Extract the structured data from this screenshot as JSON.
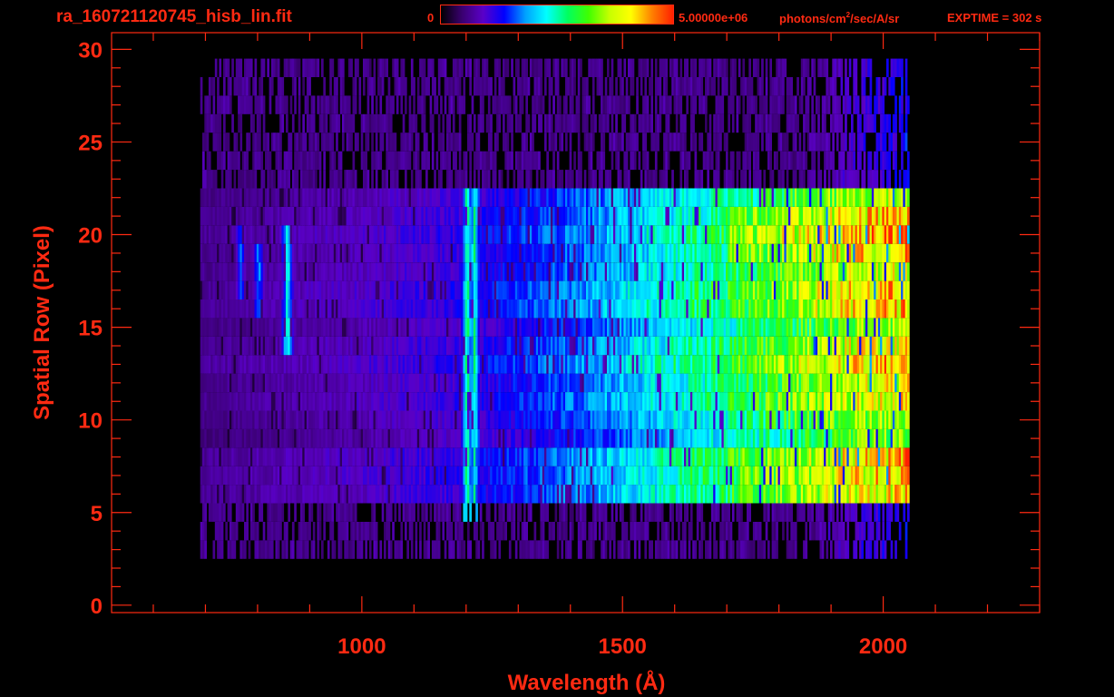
{
  "header": {
    "file_title": "ra_160721120745_hisb_lin.fit",
    "colorbar_min": "0",
    "colorbar_max": "5.00000e+06",
    "units_a": "photons/cm",
    "units_sup": "2",
    "units_b": "/sec/A/sr",
    "exptime": "EXPTIME = 302 s"
  },
  "colors": {
    "axis": "#ff2a12",
    "background": "#000000",
    "colormap": [
      "#000000",
      "#3a0070",
      "#5a00c8",
      "#0000ff",
      "#00a0ff",
      "#00ffff",
      "#00ff60",
      "#40ff00",
      "#c8ff00",
      "#ffff00",
      "#ff8000",
      "#ff2000"
    ]
  },
  "chart_data": {
    "type": "heatmap",
    "title": "ra_160721120745_hisb_lin.fit",
    "xlabel": "Wavelength (Å)",
    "ylabel": "Spatial Row (Pixel)",
    "xlim": [
      520,
      2300
    ],
    "ylim": [
      -0.4,
      30.9
    ],
    "x_ticks": [
      1000,
      1500,
      2000
    ],
    "x_tick_labels": [
      "1000",
      "1500",
      "2000"
    ],
    "y_ticks": [
      0,
      5,
      10,
      15,
      20,
      25,
      30
    ],
    "y_tick_labels": [
      "0",
      "5",
      "10",
      "15",
      "20",
      "25",
      "30"
    ],
    "color_range": [
      0,
      5000000
    ],
    "units": "photons/cm2/sec/A/sr",
    "exptime_s": 302,
    "detector_wavelength_range": [
      690,
      2050
    ],
    "slit_rows": [
      6,
      22
    ],
    "dim_rows": [
      3,
      29
    ],
    "emission_lines": [
      {
        "wavelength": 1200,
        "rows": [
          5,
          22
        ],
        "level": 0.55
      },
      {
        "wavelength": 1214,
        "rows": [
          5,
          22
        ],
        "level": 0.5
      },
      {
        "wavelength": 855,
        "rows": [
          14,
          20
        ],
        "level": 0.5
      },
      {
        "wavelength": 800,
        "rows": [
          16,
          19
        ],
        "level": 0.38
      },
      {
        "wavelength": 765,
        "rows": [
          17,
          20
        ],
        "level": 0.33
      }
    ],
    "continuum_levels": [
      {
        "wavelength": 700,
        "level": 0.12
      },
      {
        "wavelength": 1000,
        "level": 0.17
      },
      {
        "wavelength": 1200,
        "level": 0.22
      },
      {
        "wavelength": 1400,
        "level": 0.32
      },
      {
        "wavelength": 1600,
        "level": 0.46
      },
      {
        "wavelength": 1800,
        "level": 0.62
      },
      {
        "wavelength": 1950,
        "level": 0.74
      },
      {
        "wavelength": 2040,
        "level": 0.78
      }
    ]
  }
}
